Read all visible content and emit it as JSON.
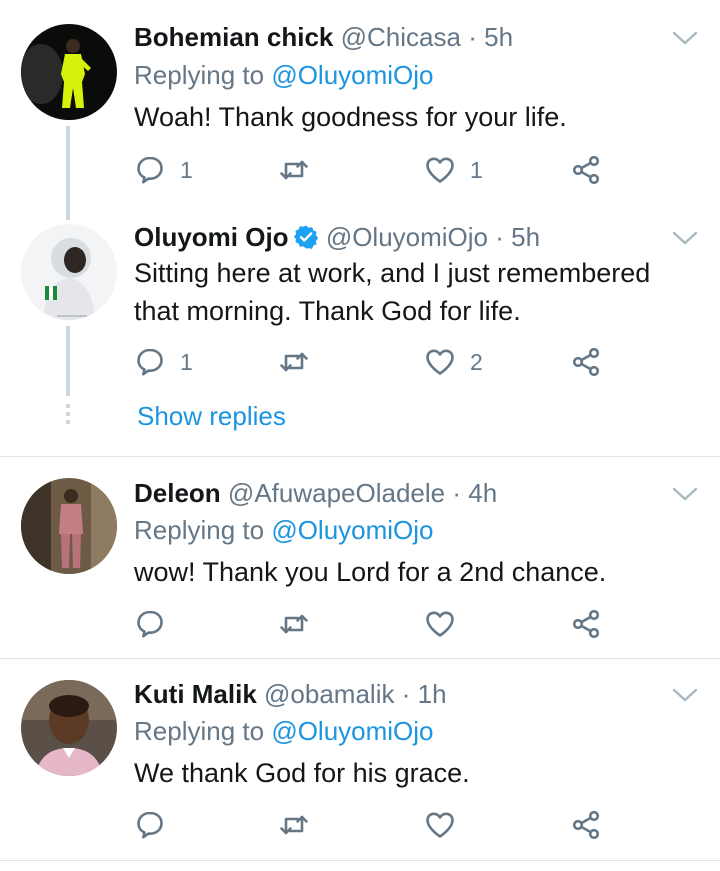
{
  "tweets": [
    {
      "name": "Bohemian chick",
      "handle": "@Chicasa",
      "dot": "·",
      "time": "5h",
      "replying_prefix": "Replying to",
      "replying_to": "@OluyomiOjo",
      "text": [
        "Woah! Thank goodness for your life."
      ],
      "reply_count": "1",
      "retweet_count": "",
      "like_count": "1"
    },
    {
      "name": "Oluyomi Ojo",
      "verified": true,
      "handle": "@OluyomiOjo",
      "dot": "·",
      "time": "5h",
      "text": [
        "Sitting here at work, and I just remembered",
        "that morning. Thank God for life."
      ],
      "reply_count": "1",
      "retweet_count": "",
      "like_count": "2"
    },
    {
      "name": "Deleon",
      "handle": "@AfuwapeOladele",
      "dot": "·",
      "time": "4h",
      "replying_prefix": "Replying to",
      "replying_to": "@OluyomiOjo",
      "text": [
        "wow!  Thank you Lord for a 2nd chance."
      ],
      "reply_count": "",
      "retweet_count": "",
      "like_count": ""
    },
    {
      "name": "Kuti Malik",
      "handle": "@obamalik",
      "dot": "·",
      "time": "1h",
      "replying_prefix": "Replying to",
      "replying_to": "@OluyomiOjo",
      "text": [
        "We thank God for his grace."
      ],
      "reply_count": "",
      "retweet_count": "",
      "like_count": ""
    }
  ],
  "show_replies": "Show replies",
  "icons": {
    "reply": "reply-icon",
    "retweet": "retweet-icon",
    "like": "heart-icon",
    "share": "share-icon",
    "menu": "chevron-down-icon",
    "verified": "verified-badge-icon"
  },
  "colors": {
    "link": "#1b95e0",
    "muted": "#657786",
    "verified": "#1da1f2",
    "text": "#14171a"
  }
}
